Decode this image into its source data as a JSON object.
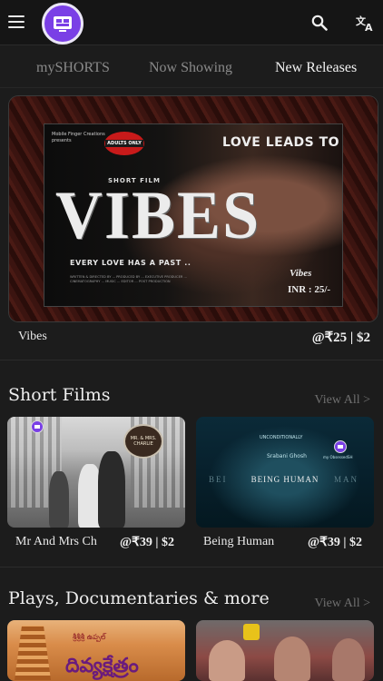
{
  "app": {
    "icons": {
      "menu": "hamburger-menu-icon",
      "logo": "app-logo",
      "search": "search-icon",
      "translate": "translate-icon"
    },
    "colors": {
      "accent": "#7a3fe6",
      "background": "#1c1c1c"
    }
  },
  "tabs": [
    {
      "label": "mySHORTS",
      "active": false
    },
    {
      "label": "Now Showing",
      "active": false
    },
    {
      "label": "New Releases",
      "active": true
    }
  ],
  "hero": {
    "poster": {
      "creators": "Mobile Finger Creations presents",
      "badge": "ADULTS ONLY",
      "tagline_top": "LOVE LEADS TO CRIME",
      "subtitle": "SHORT FILM",
      "title": "VIBES",
      "tagline_bottom": "EVERY LOVE HAS A PAST ..",
      "credits": "WRITTEN & DIRECTED BY ... PRODUCED BY ... EXECUTIVE PRODUCER ... CINEMATOGRAPHY ... MUSIC ... EDITOR ... POST PRODUCTION",
      "name": "Vibes",
      "price": "INR : 25/-"
    },
    "title": "Vibes",
    "price": "@₹25 | $2"
  },
  "sections": [
    {
      "title": "Short Films",
      "view_all": "View All >",
      "cards": [
        {
          "name": "Mr And Mrs Ch",
          "price": "@₹39 | $2",
          "poster_text": "MR. & MRS. CHARLIE"
        },
        {
          "name": "Being Human",
          "price": "@₹39 | $2",
          "poster_text": {
            "line1": "UNCONDITIONALLY",
            "line2": "Srabani Ghosh",
            "title": "BEING HUMAN",
            "ghost_left": "BEI",
            "ghost_right": "MAN",
            "brand": "my ObsessedSH"
          }
        }
      ]
    },
    {
      "title": "Plays, Documentaries & more",
      "view_all": "View All >",
      "cards": [
        {
          "poster_title": "దివ్యక్షేత్రం",
          "poster_sub": "శ్రీశ్రీశ్రీ ఉప్పల్"
        },
        {}
      ]
    }
  ]
}
